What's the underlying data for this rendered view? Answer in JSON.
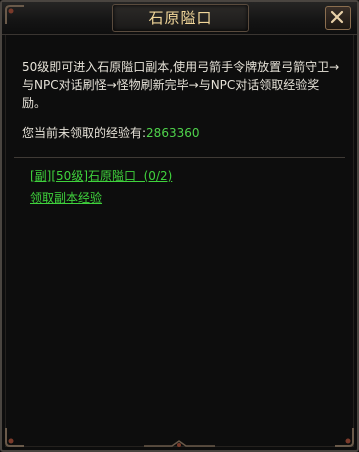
{
  "window": {
    "title": "石原隘口",
    "close_icon": "close-icon"
  },
  "content": {
    "description": "50级即可进入石原隘口副本,使用弓箭手令牌放置弓箭守卫→与NPC对话刷怪→怪物刷新完毕→与NPC对话领取经验奖励。",
    "exp_label": "您当前未领取的经验有:",
    "exp_value": "2863360"
  },
  "links": {
    "dungeon": "[副][50级]石原隘口  (0/2)",
    "claim_exp": "领取副本经验"
  },
  "colors": {
    "title": "#f2d79a",
    "link": "#3fd23c",
    "exp_value": "#4fd34b",
    "text": "#e6e2d8",
    "background": "#0d0d0d"
  }
}
